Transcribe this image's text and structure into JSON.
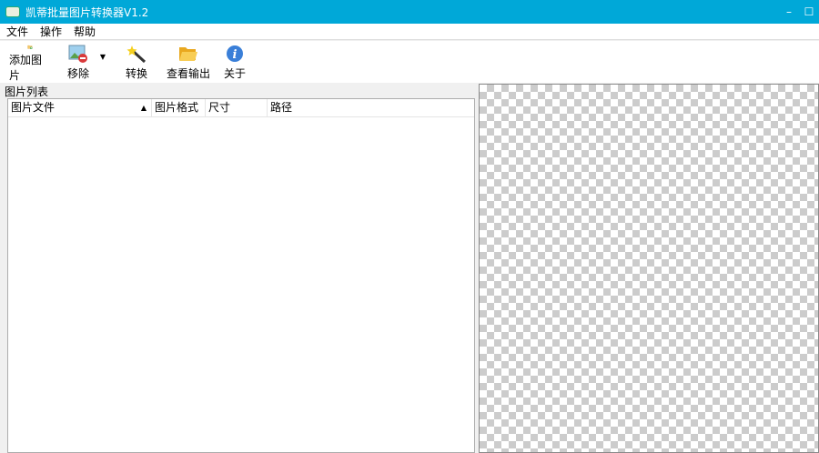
{
  "window": {
    "title": "凯蒂批量图片转换器V1.2",
    "accent": "#00a8d8",
    "controls": [
      "minimize",
      "maximize"
    ]
  },
  "menu": [
    "文件",
    "操作",
    "帮助"
  ],
  "toolbar": [
    {
      "label": "添加图片",
      "icon": "add-image-folder-icon"
    },
    {
      "label": "移除",
      "icon": "remove-image-icon"
    },
    {
      "label": "转换",
      "icon": "magic-wand-icon"
    },
    {
      "label": "查看输出",
      "icon": "open-folder-icon"
    },
    {
      "label": "关于",
      "icon": "info-icon"
    }
  ],
  "list": {
    "label": "图片列表",
    "columns": [
      "图片文件",
      "图片格式",
      "尺寸",
      "路径"
    ],
    "sort_column": "图片文件",
    "sort": "ascending",
    "rows": []
  }
}
